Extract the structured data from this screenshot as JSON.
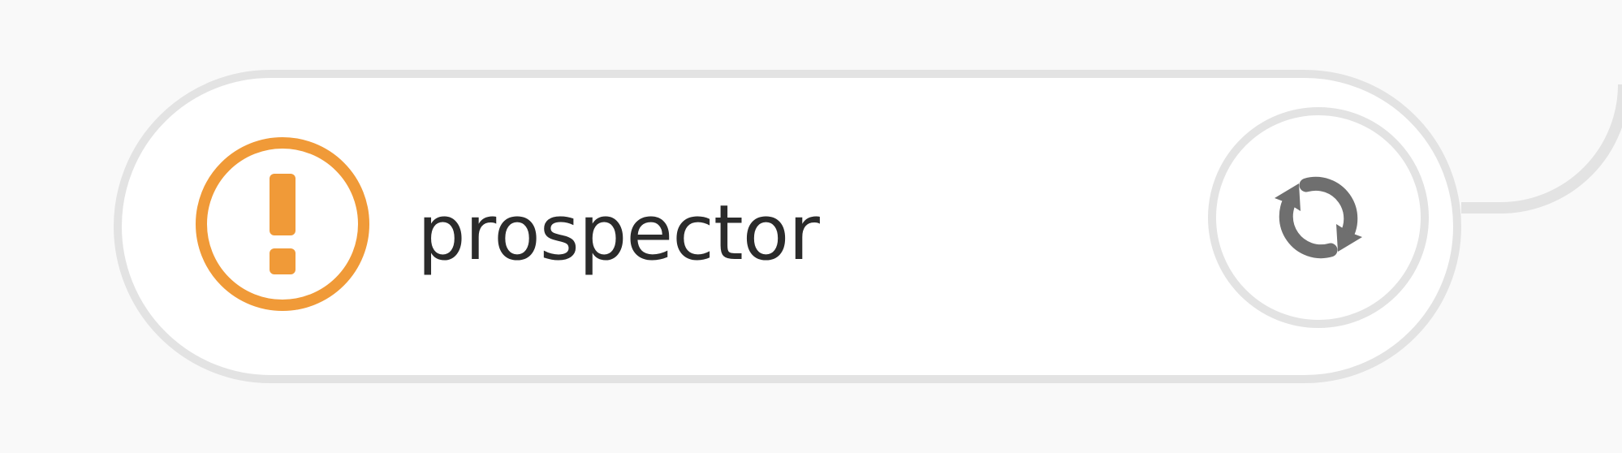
{
  "node": {
    "label": "prospector",
    "status": "warning",
    "status_icon": "exclamation-circle-icon",
    "action_icon": "refresh-icon"
  },
  "colors": {
    "warning": "#f09a38",
    "icon_gray": "#6f6f6f",
    "border": "#e3e3e3",
    "card": "#ffffff",
    "text": "#2b2b2b",
    "background": "#f9f9f9"
  }
}
